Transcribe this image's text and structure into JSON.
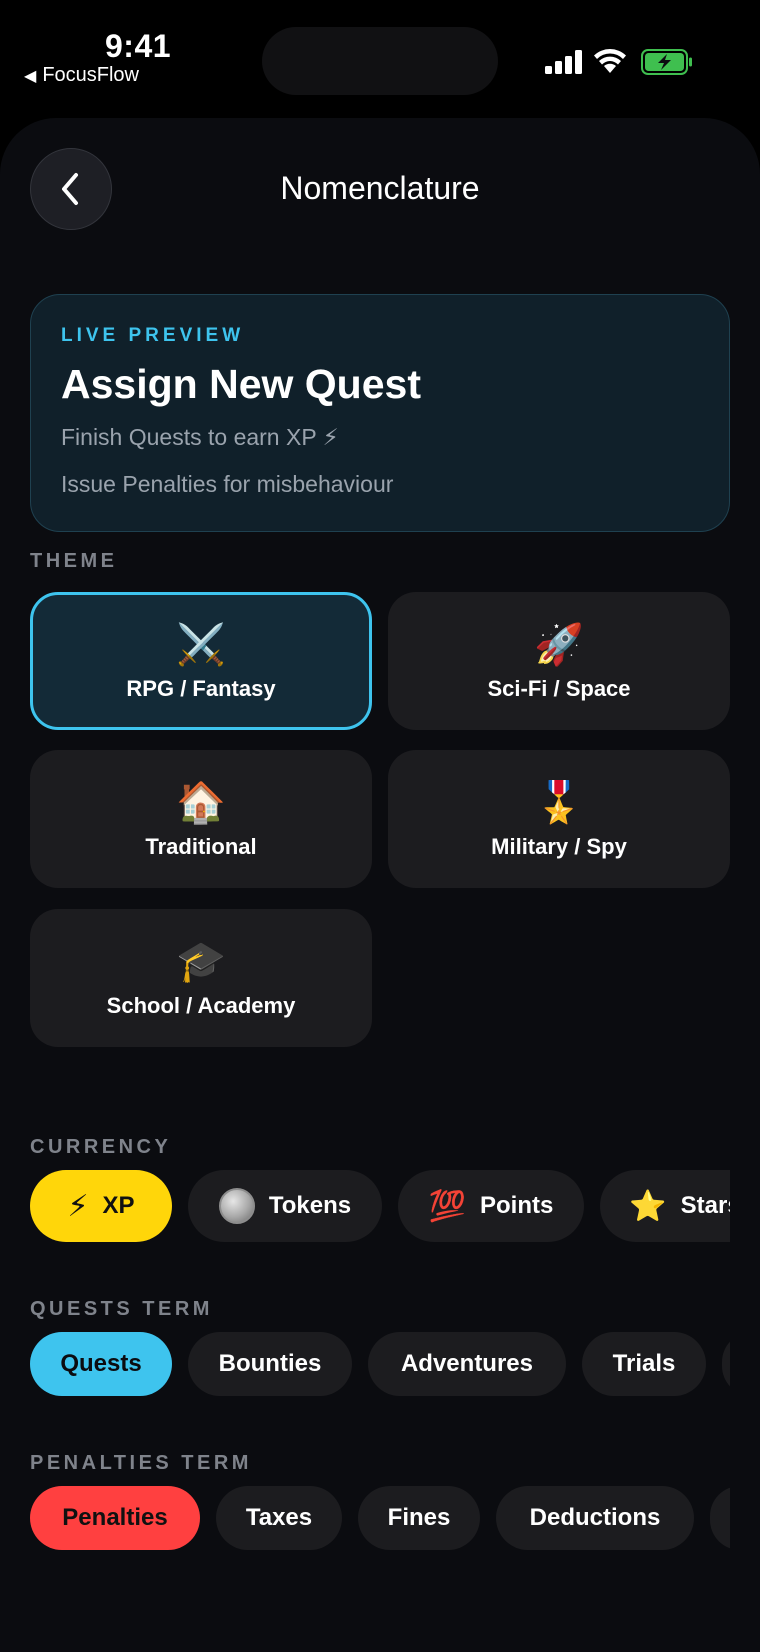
{
  "status": {
    "time": "9:41",
    "back_app_label": "FocusFlow",
    "back_app_icon": "triangle-left-icon"
  },
  "nav": {
    "title": "Nomenclature",
    "back_icon": "chevron-left-icon"
  },
  "preview": {
    "label": "LIVE PREVIEW",
    "title": "Assign New Quest",
    "line1": "Finish Quests to earn XP ⚡",
    "line2": "Issue Penalties for misbehaviour"
  },
  "theme": {
    "label": "THEME",
    "options": [
      {
        "name": "RPG / Fantasy",
        "emoji": "⚔️",
        "selected": true
      },
      {
        "name": "Sci-Fi / Space",
        "emoji": "🚀",
        "selected": false
      },
      {
        "name": "Traditional",
        "emoji": "🏠",
        "selected": false
      },
      {
        "name": "Military / Spy",
        "emoji": "🎖️",
        "selected": false
      },
      {
        "name": "School / Academy",
        "emoji": "🎓",
        "selected": false
      }
    ]
  },
  "currency": {
    "label": "CURRENCY",
    "options": [
      {
        "name": "XP",
        "icon": "⚡",
        "selected": true
      },
      {
        "name": "Tokens",
        "icon": "coin-icon",
        "selected": false
      },
      {
        "name": "Points",
        "icon": "💯",
        "selected": false
      },
      {
        "name": "Stars",
        "icon": "⭐",
        "selected": false
      }
    ]
  },
  "quests_term": {
    "label": "QUESTS TERM",
    "options": [
      "Quests",
      "Bounties",
      "Adventures",
      "Trials"
    ],
    "selected": "Quests"
  },
  "penalties_term": {
    "label": "PENALTIES TERM",
    "options": [
      "Penalties",
      "Taxes",
      "Fines",
      "Deductions"
    ],
    "selected": "Penalties"
  },
  "colors": {
    "accent": "#3ec4ee",
    "currency_selected": "#ffd60a",
    "penalty_selected": "#ff4040",
    "background": "#0b0c10",
    "card": "#1c1c1f"
  }
}
